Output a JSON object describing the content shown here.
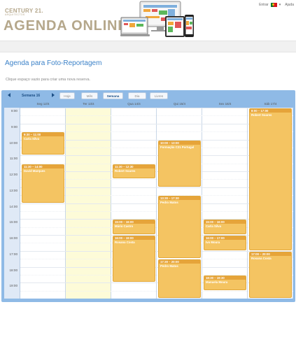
{
  "header": {
    "brand_small": "CENTURY 21.",
    "brand_sub": "ARQUITECTOS",
    "brand_big": "AGENDA ONLINE",
    "login_label": "Entrar",
    "help_label": "Ajuda",
    "language_flag": "flag-portugal-icon"
  },
  "page": {
    "title": "Agenda para Foto-Reportagem",
    "hint": "Clique espaço vazio para criar uma nova reserva."
  },
  "toolbar": {
    "prev_icon": "arrow-left-icon",
    "next_icon": "arrow-right-icon",
    "week_label": "Semana 16",
    "today_label": "Hoje",
    "month_label": "Mês",
    "week_view_label": "Semana",
    "day_label": "Dia",
    "free_label": "Livres"
  },
  "days": [
    "Seg 12/4",
    "Ter 13/4",
    "Qua 14/4",
    "Qui 15/4",
    "Sex 16/4",
    "Sáb 17/4"
  ],
  "hours": [
    "8:00",
    "9:00",
    "10:00",
    "11:00",
    "12:00",
    "13:00",
    "14:00",
    "15:00",
    "16:00",
    "17:00",
    "18:00",
    "19:00"
  ],
  "events": [
    {
      "day": 0,
      "start": 9.5,
      "end": 11.0,
      "time": "9:30 – 11:00",
      "title": "Carla Silva"
    },
    {
      "day": 0,
      "start": 11.5,
      "end": 14.0,
      "time": "11:30 – 14:00",
      "title": "David Marques"
    },
    {
      "day": 2,
      "start": 11.5,
      "end": 12.5,
      "time": "11:30 – 12:30",
      "title": "Robert Soares"
    },
    {
      "day": 2,
      "start": 15.0,
      "end": 16.0,
      "time": "15:00 – 16:00",
      "title": "Mário Castro"
    },
    {
      "day": 2,
      "start": 16.0,
      "end": 19.0,
      "time": "16:00 – 19:00",
      "title": "Rosana Costa"
    },
    {
      "day": 3,
      "start": 10.0,
      "end": 13.0,
      "time": "10:00 – 13:00",
      "title": "Formação C21 Portugal"
    },
    {
      "day": 3,
      "start": 13.5,
      "end": 17.5,
      "time": "13:30 – 17:30",
      "title": "Pedro Matos"
    },
    {
      "day": 3,
      "start": 17.5,
      "end": 20.0,
      "time": "17:30 – 20:00",
      "title": "Pedro Matos"
    },
    {
      "day": 4,
      "start": 15.0,
      "end": 16.0,
      "time": "15:00 – 16:00",
      "title": "Carla Silva"
    },
    {
      "day": 4,
      "start": 16.0,
      "end": 17.0,
      "time": "16:00 – 17:00",
      "title": "Ivo Moura"
    },
    {
      "day": 4,
      "start": 18.5,
      "end": 19.5,
      "time": "18:30 – 19:30",
      "title": "Manuela Moura"
    },
    {
      "day": 5,
      "start": 8.0,
      "end": 17.0,
      "time": "8:00 – 17:00",
      "title": "Robert Soares"
    },
    {
      "day": 5,
      "start": 17.0,
      "end": 20.0,
      "time": "17:00 – 20:00",
      "title": "Rosana Costa"
    }
  ],
  "today_index": 1,
  "colors": {
    "accent": "#3c82c8",
    "event": "#f4c462",
    "event_header": "#e6a43a",
    "calendar_frame": "#8fbae6",
    "today_bg": "#fdfbd8"
  }
}
